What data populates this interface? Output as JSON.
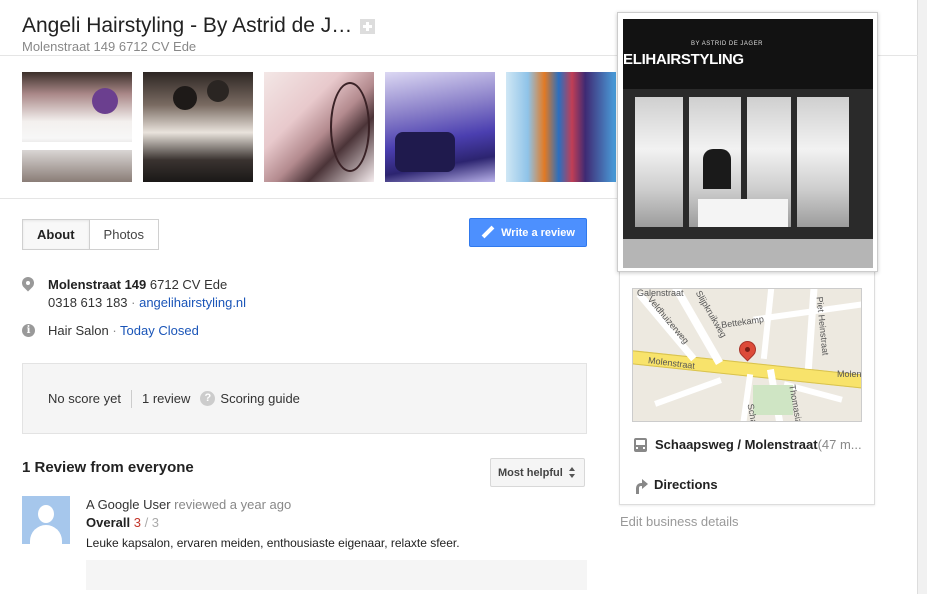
{
  "header": {
    "title": "Angeli Hairstyling - By Astrid de J…",
    "address": "Molenstraat 149 6712 CV Ede"
  },
  "photos": [
    "salon-interior-1",
    "salon-interior-2",
    "salon-interior-3",
    "salon-interior-4",
    "hair-products"
  ],
  "hero": {
    "sign_subtitle": "BY ASTRID DE JAGER",
    "sign_name": "ELIHAIRSTYLING"
  },
  "tabs": [
    {
      "label": "About",
      "active": true
    },
    {
      "label": "Photos",
      "active": false
    }
  ],
  "write_review_label": "Write a review",
  "info": {
    "street": "Molenstraat 149",
    "postal": " 6712 CV Ede",
    "phone": "0318 613 183",
    "sep1": " · ",
    "website": "angelihairstyling.nl",
    "category": "Hair Salon",
    "sep2": " · ",
    "hours": "Today Closed"
  },
  "score": {
    "no_score": "No score yet",
    "reviews": "1 review",
    "guide": "Scoring guide"
  },
  "reviews": {
    "title": "1 Review from everyone",
    "sort_label": "Most helpful",
    "items": [
      {
        "author": "A Google User",
        "meta": " reviewed a year ago",
        "overall_label": "Overall",
        "score": "3",
        "out_of": " / 3",
        "text": "Leuke kapsalon, ervaren meiden, enthousiaste eigenaar, relaxte sfeer."
      }
    ]
  },
  "map": {
    "labels": [
      "Molenstraat",
      "Molen",
      "Bettekamp",
      "Slijpkruikweg",
      "Veldhuizerweg",
      "Piet Heinstraat",
      "Thomasiz",
      "Scha",
      "Galenstraat"
    ]
  },
  "side": {
    "transit_stop": "Schaapsweg / Molenstraat",
    "transit_distance": " (47 m...",
    "directions": "Directions",
    "edit": "Edit business details"
  },
  "colors": {
    "accent_blue": "#4d90fe",
    "link": "#1a55b8",
    "score_red": "#c3352a"
  }
}
